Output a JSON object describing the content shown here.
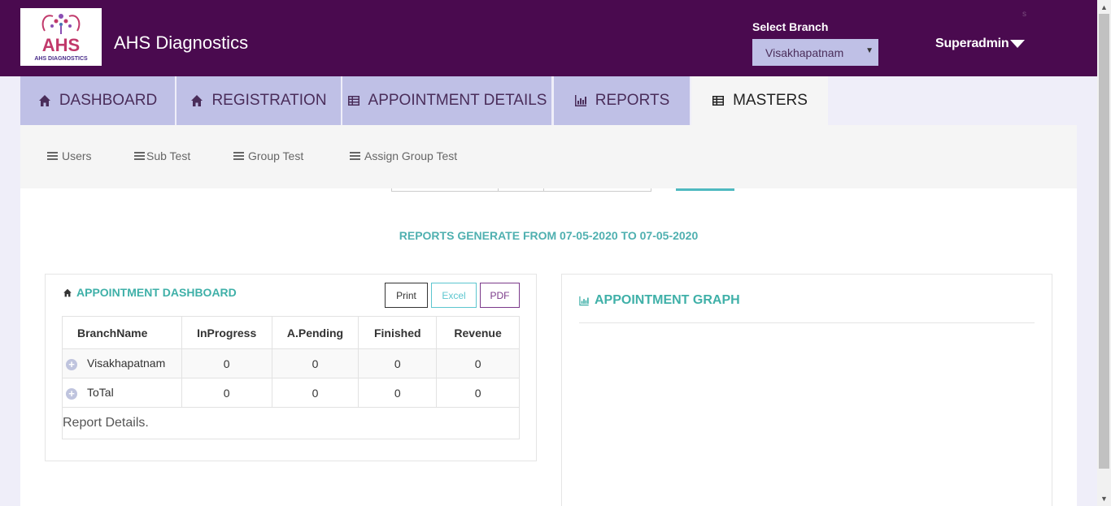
{
  "header": {
    "logo_text": "AHS DIAGNOSTICS",
    "app_title": "AHS Diagnostics",
    "branch_label": "Select Branch",
    "branch_selected": "Visakhapatnam",
    "user_name": "Superadmin",
    "tiny_mark": "s"
  },
  "tabs": [
    {
      "label": "DASHBOARD",
      "icon": "home-icon",
      "active": false
    },
    {
      "label": "REGISTRATION",
      "icon": "home-icon",
      "active": false
    },
    {
      "label": "APPOINTMENT DETAILS",
      "icon": "table-icon",
      "active": false
    },
    {
      "label": "REPORTS",
      "icon": "bar-chart-icon",
      "active": false
    },
    {
      "label": "MASTERS",
      "icon": "table-icon",
      "active": true
    }
  ],
  "subnav": [
    {
      "label": "Users"
    },
    {
      "label": "Sub Test"
    },
    {
      "label": "Group Test"
    },
    {
      "label": "Assign Group Test"
    }
  ],
  "report_range": "REPORTS GENERATE FROM 07-05-2020 TO 07-05-2020",
  "appointment_dashboard": {
    "title": "APPOINTMENT DASHBOARD",
    "buttons": {
      "print": "Print",
      "excel": "Excel",
      "pdf": "PDF"
    },
    "columns": [
      "BranchName",
      "InProgress",
      "A.Pending",
      "Finished",
      "Revenue"
    ],
    "rows": [
      {
        "branch": "Visakhapatnam",
        "in_progress": "0",
        "pending": "0",
        "finished": "0",
        "revenue": "0"
      },
      {
        "branch": "ToTal",
        "in_progress": "0",
        "pending": "0",
        "finished": "0",
        "revenue": "0"
      }
    ],
    "footer": "Report Details."
  },
  "appointment_graph": {
    "title": "APPOINTMENT GRAPH"
  },
  "colors": {
    "header_bg": "#4a0a4f",
    "tab_bg": "#bfc0e6",
    "accent_teal": "#3fb0a8"
  }
}
